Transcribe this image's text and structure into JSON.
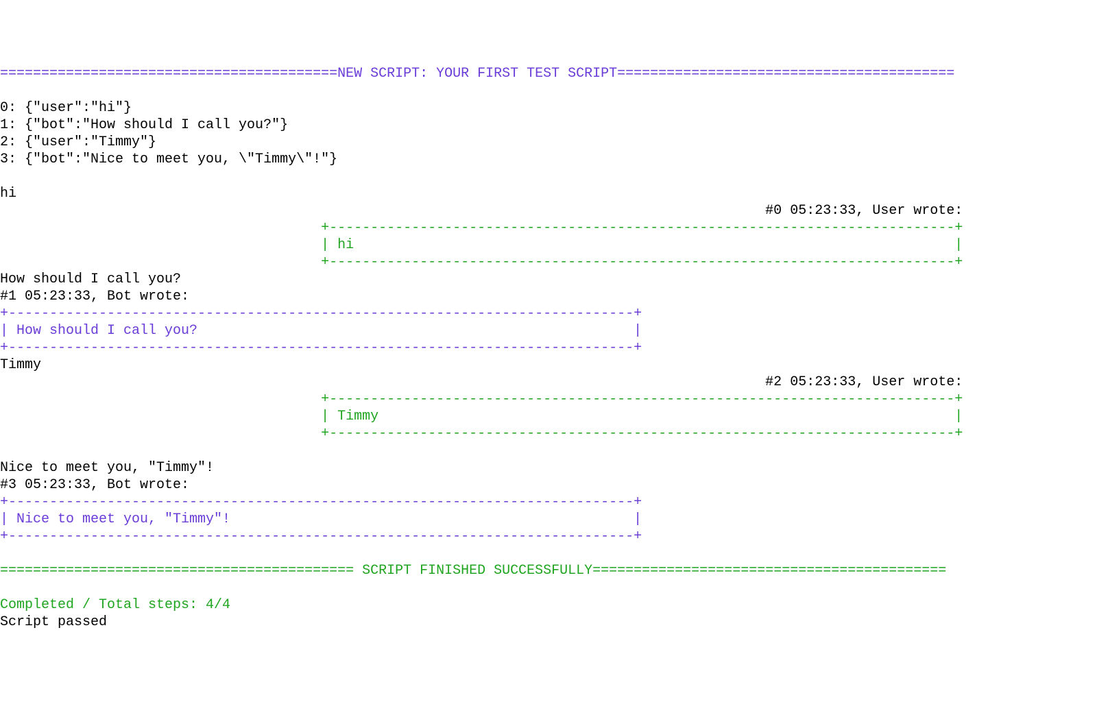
{
  "header": {
    "eq_left": "=========================================",
    "title": "NEW SCRIPT: YOUR FIRST TEST SCRIPT",
    "eq_right": "========================================="
  },
  "script_lines": [
    "0: {\"user\":\"hi\"}",
    "1: {\"bot\":\"How should I call you?\"}",
    "2: {\"user\":\"Timmy\"}",
    "3: {\"bot\":\"Nice to meet you, \\\"Timmy\\\"!\"}"
  ],
  "entries": [
    {
      "raw": "hi",
      "stamp": "#0 05:23:33, User wrote:",
      "stamp_align": "right",
      "box_align": "right",
      "box_color": "green",
      "box_top": "+----------------------------------------------------------------------------+",
      "box_mid": "| hi                                                                         |",
      "box_bottom": "+----------------------------------------------------------------------------+"
    },
    {
      "raw": "How should I call you?",
      "stamp": "#1 05:23:33, Bot wrote:",
      "stamp_align": "left",
      "box_align": "left",
      "box_color": "purple",
      "box_top": "+----------------------------------------------------------------------------+",
      "box_mid": "| How should I call you?                                                     |",
      "box_bottom": "+----------------------------------------------------------------------------+"
    },
    {
      "raw": "Timmy",
      "stamp": "#2 05:23:33, User wrote:",
      "stamp_align": "right",
      "box_align": "right",
      "box_color": "green",
      "box_top": "+----------------------------------------------------------------------------+",
      "box_mid": "| Timmy                                                                      |",
      "box_bottom": "+----------------------------------------------------------------------------+",
      "trailing_blank": true
    },
    {
      "raw": "Nice to meet you, \"Timmy\"!",
      "stamp": "#3 05:23:33, Bot wrote:",
      "stamp_align": "left",
      "box_align": "left",
      "box_color": "purple",
      "box_top": "+----------------------------------------------------------------------------+",
      "box_mid": "| Nice to meet you, \"Timmy\"!                                                 |",
      "box_bottom": "+----------------------------------------------------------------------------+"
    }
  ],
  "footer": {
    "eq_left": "===========================================",
    "title": " SCRIPT FINISHED SUCCESSFULLY",
    "eq_right": "===========================================",
    "completed": "Completed / Total steps: 4/4",
    "passed": "Script passed"
  },
  "layout": {
    "total_cols": 117,
    "indent_cols": 39
  }
}
